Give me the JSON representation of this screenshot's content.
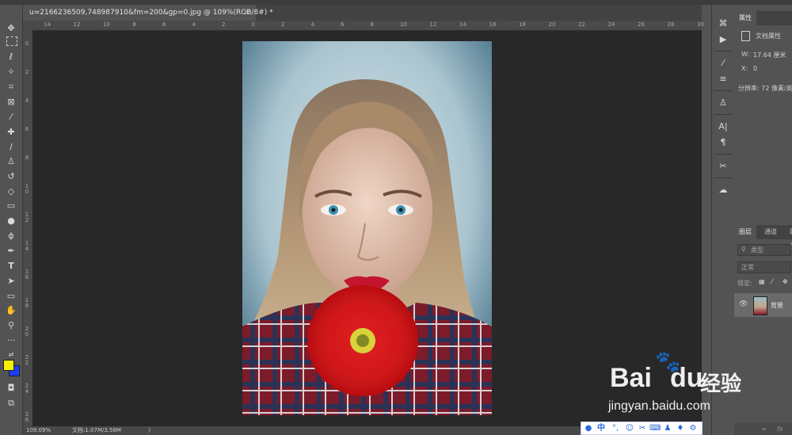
{
  "document": {
    "tab_title": "u=2166236509,748987910&fm=200&gp=0.jpg @ 109%(RGB/8#) *",
    "tab_close": "×"
  },
  "status": {
    "zoom": "109.09%",
    "doc_info": "文档:1.07M/3.58M",
    "arrow": "〉"
  },
  "rulers": {
    "top": [
      "14",
      "12",
      "10",
      "8",
      "6",
      "4",
      "2",
      "0",
      "2",
      "4",
      "6",
      "8",
      "10",
      "12",
      "14",
      "16",
      "18",
      "20",
      "22",
      "24",
      "26",
      "28",
      "30"
    ],
    "left": [
      "0",
      "2",
      "4",
      "6",
      "8",
      "1 0",
      "1 2",
      "1 4",
      "1 6",
      "1 8",
      "2 0",
      "2 2",
      "2 4",
      "2 6"
    ]
  },
  "properties_panel": {
    "tab_label": "属性",
    "doc_props_label": "文档属性",
    "width_label": "W:",
    "width_value": "17.64 厘米",
    "x_label": "X:",
    "x_value": "0",
    "resolution": "分辨率: 72 像素/英"
  },
  "layers_panel": {
    "tabs": [
      "图层",
      "通道",
      "路径"
    ],
    "kind_placeholder": "类型",
    "blend_mode": "正常",
    "lock_label": "锁定:",
    "layer_name": "背景"
  },
  "watermark": {
    "brand": "Bai",
    "brand_suffix": "du",
    "product": "经验",
    "url": "jingyan.baidu.com"
  },
  "ime": {
    "mode": "中",
    "punct": "°,"
  },
  "colors": {
    "foreground": "#f5f000",
    "background": "#1a3cff"
  }
}
